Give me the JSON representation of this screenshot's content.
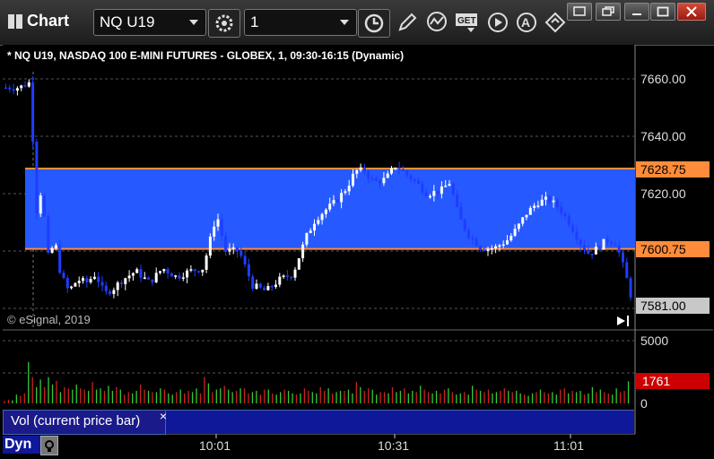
{
  "window": {
    "title": "Chart",
    "symbol_value": "NQ U19",
    "interval_value": "1"
  },
  "chart_info": {
    "header": "* NQ U19, NASDAQ 100 E-MINI FUTURES - GLOBEX, 1, 09:30-16:15 (Dynamic)",
    "copyright": "© eSignal, 2019",
    "band_top_label": "7628.75",
    "band_bottom_label": "7600.75",
    "last_price_label": "7581.00",
    "volume_label": "1761",
    "legend": "Vol (current price bar)",
    "dyn_label": "Dyn",
    "close_x": "×"
  },
  "colors": {
    "band": "#2659ff",
    "band_line": "#ff8c3a",
    "up_candle": "#ffffff",
    "down_candle": "#1f3dff",
    "vol_up": "#33cc33",
    "vol_down": "#cc2222",
    "volume_tag": "#cc0000"
  },
  "icons": [
    "clock-icon",
    "pencil-icon",
    "study-icon",
    "get-icon",
    "play-icon",
    "alert-icon",
    "diamond-icon"
  ],
  "chart_data": {
    "type": "candlestick",
    "price_axis_ticks": [
      "7660.00",
      "7640.00",
      "7620.00"
    ],
    "volume_axis_ticks": [
      "5000",
      "0"
    ],
    "time_axis_ticks": [
      "10:01",
      "10:31",
      "11:01"
    ],
    "price_range": [
      7575,
      7670
    ],
    "band": {
      "top": 7628.75,
      "bottom": 7600.75
    },
    "last_price": 7581.0,
    "volume_range": [
      0,
      5000
    ],
    "current_volume": 1761,
    "volume_values": [
      200,
      300,
      250,
      700,
      600,
      800,
      3300,
      2100,
      1300,
      1900,
      1300,
      2100,
      1500,
      1800,
      900,
      1300,
      1200,
      1100,
      1500,
      1200,
      1100,
      1000,
      1700,
      1100,
      1200,
      1000,
      1400,
      1000,
      1300,
      1100,
      700,
      900,
      800,
      1000,
      1500,
      1100,
      1000,
      900,
      900,
      1200,
      1100,
      800,
      700,
      900,
      1100,
      800,
      1000,
      900,
      1200,
      800,
      2100,
      1600,
      900,
      1100,
      1200,
      1400,
      1100,
      900,
      1000,
      1200,
      1200,
      800,
      900,
      1000,
      700,
      1100,
      1100,
      800,
      700,
      900,
      1100,
      1000,
      800,
      700,
      800,
      1200,
      1000,
      900,
      800,
      1300,
      1000,
      1200,
      800,
      900,
      1000,
      1000,
      1100,
      800,
      1700,
      1300,
      1000,
      1200,
      1100,
      700,
      900,
      900,
      800,
      1300,
      900,
      1000,
      1200,
      800,
      1000,
      900,
      1400,
      1100,
      900,
      800,
      1000,
      800,
      1100,
      1200,
      900,
      700,
      800,
      900,
      700,
      1400,
      1100,
      1000,
      900,
      1100,
      800,
      900,
      1000,
      1200,
      1000,
      900,
      1000,
      800,
      700,
      600,
      800,
      900,
      1100,
      900,
      800,
      900,
      700,
      1100,
      1200,
      800,
      1000,
      900,
      1000,
      700,
      800,
      1300,
      900,
      1100,
      900,
      800,
      700,
      1200,
      900,
      1000,
      1761
    ]
  }
}
